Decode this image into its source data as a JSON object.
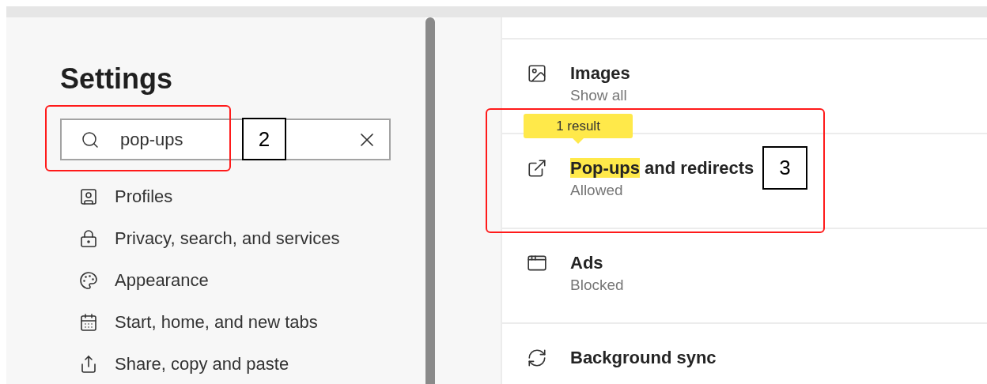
{
  "sidebar": {
    "title": "Settings",
    "search": {
      "value": "pop-ups"
    },
    "items": [
      {
        "label": "Profiles"
      },
      {
        "label": "Privacy, search, and services"
      },
      {
        "label": "Appearance"
      },
      {
        "label": "Start, home, and new tabs"
      },
      {
        "label": "Share, copy and paste"
      }
    ]
  },
  "content": {
    "rows": [
      {
        "title_parts": [
          {
            "text": "Images",
            "highlighted": false
          }
        ],
        "subtitle": "Show all"
      },
      {
        "title_parts": [
          {
            "text": "Pop-ups",
            "highlighted": true
          },
          {
            "text": " and redirects",
            "highlighted": false
          }
        ],
        "subtitle": "Allowed",
        "tooltip": "1 result"
      },
      {
        "title_parts": [
          {
            "text": "Ads",
            "highlighted": false
          }
        ],
        "subtitle": "Blocked"
      },
      {
        "title_parts": [
          {
            "text": "Background sync",
            "highlighted": false
          }
        ]
      }
    ]
  },
  "annotations": [
    {
      "label": "2"
    },
    {
      "label": "3"
    }
  ]
}
